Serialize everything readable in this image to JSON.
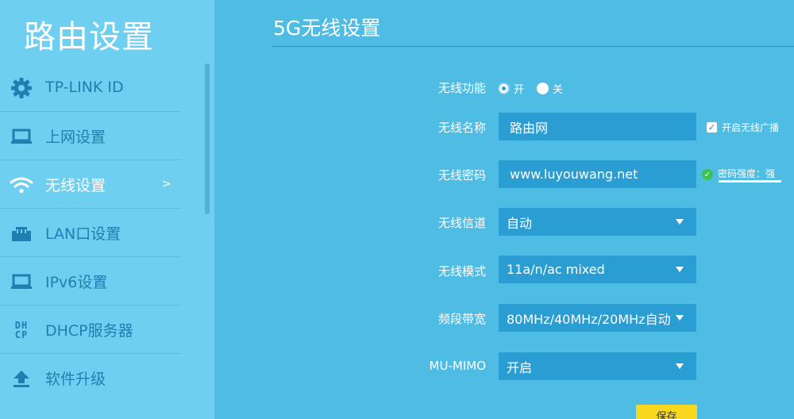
{
  "app_title": "路由设置",
  "sidebar": {
    "items": [
      {
        "label": "TP-LINK ID",
        "icon": "gear-icon"
      },
      {
        "label": "上网设置",
        "icon": "laptop-icon"
      },
      {
        "label": "无线设置",
        "icon": "wifi-icon",
        "active": true,
        "arrow": ">"
      },
      {
        "label": "LAN口设置",
        "icon": "ethernet-port-icon"
      },
      {
        "label": "IPv6设置",
        "icon": "laptop-icon"
      },
      {
        "label": "DHCP服务器",
        "icon": "dhcp-icon",
        "glyph_top": "DHCP",
        "glyph_l1": "DH",
        "glyph_l2": "CP"
      },
      {
        "label": "软件升级",
        "icon": "upload-icon"
      }
    ]
  },
  "main": {
    "title": "5G无线设置",
    "wireless_function": {
      "label": "无线功能",
      "on": "开",
      "off": "关",
      "selected": "开"
    },
    "ssid": {
      "label": "无线名称",
      "value": "路由网",
      "broadcast_label": "开启无线广播",
      "broadcast_checked": true
    },
    "password": {
      "label": "无线密码",
      "value": "www.luyouwang.net",
      "strength_text": "密码强度：强"
    },
    "channel": {
      "label": "无线信道",
      "value": "自动"
    },
    "mode": {
      "label": "无线模式",
      "value": "11a/n/ac mixed"
    },
    "bandwidth": {
      "label": "频段带宽",
      "value": "80MHz/40MHz/20MHz自动"
    },
    "mumimo": {
      "label": "MU-MIMO",
      "value": "开启"
    },
    "save_label": "保存"
  },
  "colors": {
    "main_bg": "#4fbde3",
    "sidebar_bg": "#6fcff0",
    "field_bg": "#2a9dd2",
    "nav_text": "#1f7fb0",
    "save_button": "#f7d81e",
    "ok_green": "#3cc24f"
  }
}
